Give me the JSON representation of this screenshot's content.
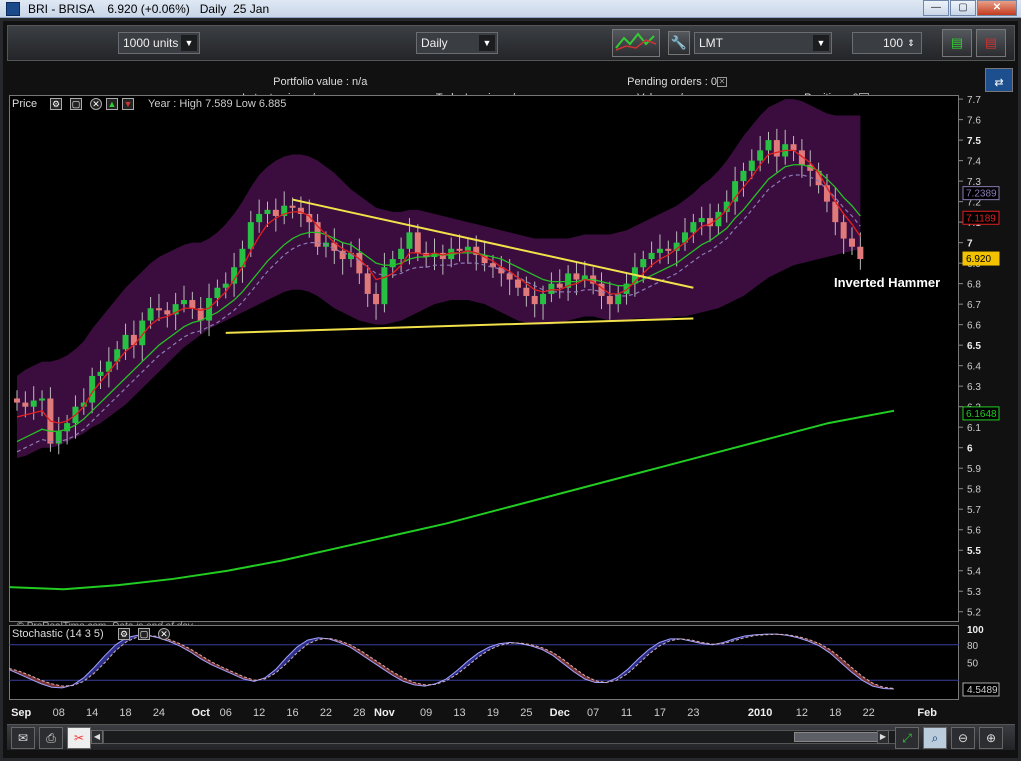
{
  "window": {
    "title": "BRI - BRISA    6.920 (+0.06%)   Daily  25 Jan",
    "min": "—",
    "max": "▢",
    "close": "✕"
  },
  "toolbar": {
    "units": "1000 units",
    "period": "Daily",
    "order_type": "LMT",
    "quantity": "100"
  },
  "info": {
    "portfolio_label": "Portfolio value :",
    "portfolio_value": "n/a",
    "pending_label": "Pending orders :",
    "pending_value": "0",
    "latent_label": "Latent gain :",
    "latent_value": "n/a",
    "today_label": "Today's gain :",
    "today_value": "n/a",
    "value_label": "Value :",
    "value_value": "n/a",
    "position_label": "Position :",
    "position_value": "0"
  },
  "price_panel": {
    "label": "Price",
    "year_summary": "Year : High 7.589 Low 6.885",
    "watermark": "© ProRealTime.com",
    "data_note": "Data is end of day",
    "annotation": "Inverted Hammer"
  },
  "stoch_panel": {
    "label": "Stochastic (14 3 5)"
  },
  "colors": {
    "band": "#3a0d3e",
    "up": "#27c043",
    "down": "#e07a7a",
    "sma_short": "#e02020",
    "sma_mid": "#25c025",
    "sma_long": "#22cc22",
    "trend": "#f2e14a",
    "stoch_pos": "#2c2f8a",
    "stoch_neg": "#7a3535"
  },
  "chart_data": {
    "type": "candlestick",
    "ylim": [
      5.15,
      7.72
    ],
    "yticks": [
      7.7,
      7.6,
      7.5,
      7.4,
      7.3,
      7.2,
      7.1,
      7,
      6.9,
      6.8,
      6.7,
      6.6,
      6.5,
      6.4,
      6.3,
      6.2,
      6.1,
      6,
      5.9,
      5.8,
      5.7,
      5.6,
      5.5,
      5.4,
      5.3,
      5.2
    ],
    "ytick_bold": [
      7.5,
      7,
      6.5,
      6,
      5.5
    ],
    "price_tags": [
      {
        "value": 7.2389,
        "label": "7.2389",
        "color": "#8c7ab5"
      },
      {
        "value": 7.1189,
        "label": "7.1189",
        "color": "#e02020"
      },
      {
        "value": 6.92,
        "label": "6.920",
        "color": "#f2c200"
      },
      {
        "value": 6.1648,
        "label": "6.1648",
        "color": "#22cc22"
      }
    ],
    "xticks": [
      {
        "label": "Sep",
        "bold": true,
        "i": 0.5
      },
      {
        "label": "08",
        "i": 5
      },
      {
        "label": "14",
        "i": 9
      },
      {
        "label": "18",
        "i": 13
      },
      {
        "label": "24",
        "i": 17
      },
      {
        "label": "Oct",
        "bold": true,
        "i": 22
      },
      {
        "label": "06",
        "i": 25
      },
      {
        "label": "12",
        "i": 29
      },
      {
        "label": "16",
        "i": 33
      },
      {
        "label": "22",
        "i": 37
      },
      {
        "label": "28",
        "i": 41
      },
      {
        "label": "Nov",
        "bold": true,
        "i": 44
      },
      {
        "label": "09",
        "i": 49
      },
      {
        "label": "13",
        "i": 53
      },
      {
        "label": "19",
        "i": 57
      },
      {
        "label": "25",
        "i": 61
      },
      {
        "label": "Dec",
        "bold": true,
        "i": 65
      },
      {
        "label": "07",
        "i": 69
      },
      {
        "label": "11",
        "i": 73
      },
      {
        "label": "17",
        "i": 77
      },
      {
        "label": "23",
        "i": 81
      },
      {
        "label": "2010",
        "bold": true,
        "i": 89
      },
      {
        "label": "12",
        "i": 94
      },
      {
        "label": "18",
        "i": 98
      },
      {
        "label": "22",
        "i": 102
      },
      {
        "label": "Feb",
        "bold": true,
        "i": 109
      }
    ],
    "closes": [
      6.22,
      6.2,
      6.23,
      6.24,
      6.02,
      6.08,
      6.12,
      6.2,
      6.22,
      6.35,
      6.37,
      6.42,
      6.48,
      6.55,
      6.5,
      6.62,
      6.68,
      6.67,
      6.65,
      6.7,
      6.72,
      6.68,
      6.62,
      6.73,
      6.78,
      6.8,
      6.88,
      6.97,
      7.1,
      7.14,
      7.16,
      7.13,
      7.18,
      7.17,
      7.14,
      7.1,
      6.98,
      7.0,
      6.96,
      6.92,
      6.95,
      6.85,
      6.75,
      6.7,
      6.88,
      6.92,
      6.97,
      7.05,
      6.95,
      6.93,
      6.95,
      6.92,
      6.97,
      6.96,
      6.98,
      6.94,
      6.9,
      6.88,
      6.85,
      6.82,
      6.78,
      6.74,
      6.7,
      6.75,
      6.8,
      6.78,
      6.85,
      6.82,
      6.84,
      6.8,
      6.74,
      6.7,
      6.75,
      6.8,
      6.88,
      6.92,
      6.95,
      6.97,
      6.96,
      7.0,
      7.05,
      7.1,
      7.12,
      7.08,
      7.15,
      7.2,
      7.3,
      7.35,
      7.4,
      7.45,
      7.5,
      7.42,
      7.48,
      7.45,
      7.38,
      7.35,
      7.28,
      7.2,
      7.1,
      7.02,
      6.98,
      6.92
    ],
    "sma_short": [
      6.15,
      6.16,
      6.17,
      6.18,
      6.13,
      6.12,
      6.13,
      6.16,
      6.2,
      6.27,
      6.32,
      6.37,
      6.42,
      6.47,
      6.5,
      6.55,
      6.6,
      6.63,
      6.64,
      6.66,
      6.68,
      6.68,
      6.67,
      6.68,
      6.72,
      6.76,
      6.82,
      6.88,
      6.96,
      7.03,
      7.09,
      7.12,
      7.14,
      7.15,
      7.15,
      7.13,
      7.08,
      7.04,
      7.0,
      6.97,
      6.95,
      6.92,
      6.88,
      6.82,
      6.83,
      6.85,
      6.89,
      6.95,
      6.95,
      6.94,
      6.95,
      6.94,
      6.95,
      6.95,
      6.96,
      6.95,
      6.93,
      6.91,
      6.88,
      6.86,
      6.83,
      6.8,
      6.77,
      6.76,
      6.77,
      6.77,
      6.79,
      6.8,
      6.82,
      6.81,
      6.78,
      6.75,
      6.75,
      6.77,
      6.81,
      6.85,
      6.89,
      6.92,
      6.94,
      6.97,
      7.0,
      7.04,
      7.08,
      7.09,
      7.12,
      7.16,
      7.22,
      7.27,
      7.32,
      7.38,
      7.43,
      7.44,
      7.45,
      7.45,
      7.42,
      7.39,
      7.34,
      7.27,
      7.2,
      7.14,
      7.09,
      7.03
    ],
    "sma_mid": [
      6.03,
      6.05,
      6.07,
      6.09,
      6.08,
      6.08,
      6.09,
      6.11,
      6.14,
      6.18,
      6.22,
      6.26,
      6.3,
      6.34,
      6.38,
      6.42,
      6.46,
      6.5,
      6.53,
      6.56,
      6.59,
      6.61,
      6.62,
      6.64,
      6.66,
      6.69,
      6.72,
      6.76,
      6.81,
      6.86,
      6.91,
      6.95,
      6.99,
      7.02,
      7.04,
      7.05,
      7.05,
      7.04,
      7.02,
      7.0,
      6.99,
      6.96,
      6.93,
      6.9,
      6.89,
      6.89,
      6.9,
      6.92,
      6.93,
      6.93,
      6.94,
      6.94,
      6.94,
      6.95,
      6.95,
      6.95,
      6.94,
      6.93,
      6.92,
      6.9,
      6.88,
      6.86,
      6.84,
      6.82,
      6.81,
      6.81,
      6.81,
      6.81,
      6.82,
      6.82,
      6.81,
      6.8,
      6.79,
      6.79,
      6.8,
      6.82,
      6.84,
      6.86,
      6.88,
      6.9,
      6.93,
      6.96,
      6.99,
      7.01,
      7.04,
      7.07,
      7.12,
      7.16,
      7.21,
      7.26,
      7.31,
      7.34,
      7.37,
      7.38,
      7.38,
      7.37,
      7.35,
      7.31,
      7.27,
      7.22,
      7.18,
      7.13
    ],
    "band_upper": [
      6.35,
      6.38,
      6.4,
      6.42,
      6.42,
      6.43,
      6.45,
      6.48,
      6.52,
      6.58,
      6.63,
      6.68,
      6.73,
      6.78,
      6.82,
      6.86,
      6.9,
      6.93,
      6.95,
      6.97,
      6.99,
      7.0,
      7.0,
      7.02,
      7.05,
      7.09,
      7.14,
      7.2,
      7.27,
      7.33,
      7.37,
      7.4,
      7.42,
      7.43,
      7.43,
      7.42,
      7.4,
      7.37,
      7.34,
      7.3,
      7.26,
      7.23,
      7.2,
      7.17,
      7.16,
      7.15,
      7.15,
      7.16,
      7.16,
      7.15,
      7.14,
      7.13,
      7.12,
      7.11,
      7.1,
      7.09,
      7.08,
      7.07,
      7.06,
      7.05,
      7.04,
      7.03,
      7.02,
      7.02,
      7.02,
      7.02,
      7.02,
      7.03,
      7.04,
      7.04,
      7.04,
      7.04,
      7.05,
      7.06,
      7.08,
      7.1,
      7.12,
      7.14,
      7.16,
      7.18,
      7.21,
      7.24,
      7.28,
      7.31,
      7.35,
      7.4,
      7.46,
      7.52,
      7.57,
      7.62,
      7.66,
      7.68,
      7.7,
      7.7,
      7.69,
      7.67,
      7.65,
      7.63,
      7.62,
      7.62,
      7.62,
      7.62
    ],
    "band_lower": [
      5.95,
      5.96,
      5.98,
      6.0,
      6.0,
      6.01,
      6.03,
      6.05,
      6.07,
      6.1,
      6.12,
      6.15,
      6.18,
      6.21,
      6.25,
      6.29,
      6.33,
      6.37,
      6.41,
      6.45,
      6.49,
      6.52,
      6.55,
      6.58,
      6.6,
      6.62,
      6.64,
      6.66,
      6.68,
      6.7,
      6.72,
      6.74,
      6.76,
      6.77,
      6.77,
      6.76,
      6.74,
      6.71,
      6.68,
      6.66,
      6.64,
      6.62,
      6.61,
      6.6,
      6.6,
      6.61,
      6.62,
      6.64,
      6.66,
      6.68,
      6.7,
      6.71,
      6.72,
      6.72,
      6.72,
      6.71,
      6.7,
      6.68,
      6.66,
      6.64,
      6.62,
      6.61,
      6.6,
      6.6,
      6.6,
      6.61,
      6.62,
      6.63,
      6.64,
      6.64,
      6.63,
      6.62,
      6.62,
      6.62,
      6.63,
      6.63,
      6.63,
      6.63,
      6.63,
      6.64,
      6.64,
      6.65,
      6.66,
      6.67,
      6.68,
      6.7,
      6.72,
      6.74,
      6.77,
      6.8,
      6.83,
      6.85,
      6.87,
      6.89,
      6.9,
      6.91,
      6.92,
      6.93,
      6.94,
      6.95,
      6.96,
      6.97
    ],
    "sma_long": [
      [
        0,
        5.32
      ],
      [
        10,
        5.31
      ],
      [
        20,
        5.33
      ],
      [
        30,
        5.36
      ],
      [
        40,
        5.4
      ],
      [
        50,
        5.45
      ],
      [
        60,
        5.51
      ],
      [
        70,
        5.57
      ],
      [
        80,
        5.63
      ],
      [
        90,
        5.7
      ],
      [
        100,
        5.77
      ],
      [
        110,
        5.84
      ],
      [
        120,
        5.91
      ],
      [
        130,
        5.98
      ],
      [
        140,
        6.05
      ],
      [
        150,
        6.12
      ],
      [
        162,
        6.18
      ]
    ],
    "trendlines": [
      {
        "from": [
          33,
          7.21
        ],
        "to": [
          81,
          6.78
        ]
      },
      {
        "from": [
          25,
          6.56
        ],
        "to": [
          81,
          6.63
        ]
      }
    ],
    "annotation_index": 101,
    "stochastic": {
      "ylim": [
        0,
        100
      ],
      "levels": [
        80,
        20
      ],
      "axis_labels": [
        "100",
        "80",
        "50",
        "4.5489"
      ],
      "k": [
        38,
        30,
        22,
        14,
        8,
        7,
        12,
        24,
        42,
        62,
        80,
        92,
        96,
        96,
        92,
        86,
        78,
        68,
        56,
        46,
        38,
        30,
        22,
        18,
        24,
        38,
        58,
        76,
        88,
        92,
        90,
        84,
        76,
        64,
        52,
        40,
        28,
        18,
        12,
        10,
        14,
        22,
        36,
        52,
        66,
        76,
        82,
        84,
        82,
        78,
        72,
        62,
        48,
        34,
        22,
        16,
        16,
        24,
        38,
        56,
        72,
        84,
        90,
        90,
        86,
        82,
        80,
        84,
        90,
        95,
        97,
        98,
        98,
        96,
        92,
        86,
        78,
        66,
        50,
        34,
        20,
        10,
        6,
        5
      ],
      "d": [
        40,
        35,
        28,
        20,
        14,
        10,
        11,
        18,
        32,
        50,
        70,
        85,
        93,
        96,
        94,
        89,
        82,
        73,
        62,
        51,
        42,
        34,
        26,
        20,
        22,
        32,
        48,
        66,
        81,
        89,
        91,
        87,
        80,
        70,
        58,
        46,
        34,
        24,
        16,
        12,
        13,
        19,
        30,
        44,
        59,
        71,
        79,
        83,
        83,
        80,
        75,
        67,
        55,
        41,
        28,
        19,
        16,
        20,
        31,
        47,
        64,
        78,
        87,
        90,
        88,
        84,
        81,
        82,
        87,
        92,
        96,
        97,
        98,
        97,
        94,
        89,
        82,
        72,
        58,
        42,
        27,
        15,
        8,
        6
      ]
    }
  },
  "bottom": {
    "mail_icon": "mail-icon",
    "print_icon": "printer-icon"
  }
}
